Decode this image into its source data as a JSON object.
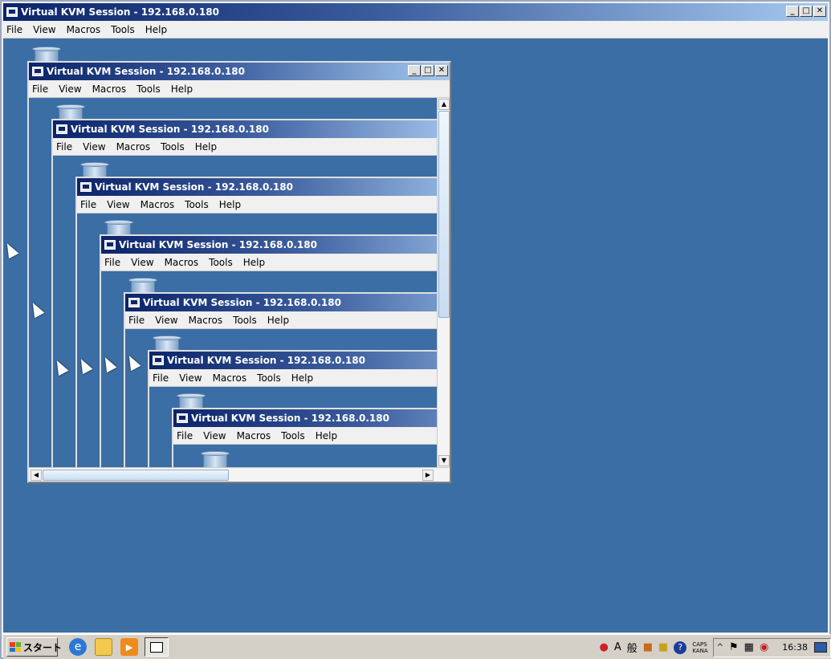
{
  "window": {
    "title": "Virtual KVM Session - 192.168.0.180",
    "controls": {
      "minimize": "_",
      "maximize": "□",
      "close": "✕"
    }
  },
  "menu": {
    "file": "File",
    "view": "View",
    "macros": "Macros",
    "tools": "Tools",
    "help": "Help"
  },
  "nested_sessions": {
    "title": "Virtual KVM Session - 192.168.0.180",
    "depth_visible": 7
  },
  "scrollbars": {
    "up": "▲",
    "down": "▼",
    "left": "◀",
    "right": "▶"
  },
  "taskbar": {
    "start_label": "スタート",
    "quick_launch": [
      "ie-icon",
      "folder-icon",
      "media-player-icon"
    ],
    "active_task_icon": "kvm-window-icon",
    "tray": {
      "ime_a": "A",
      "ime_mode": "般",
      "caps": "CAPS",
      "kana": "KANA",
      "clock": "16:38"
    }
  },
  "colors": {
    "desktop": "#3b6ea5",
    "titlebar_start": "#0b246a",
    "titlebar_end": "#a6caf0"
  }
}
